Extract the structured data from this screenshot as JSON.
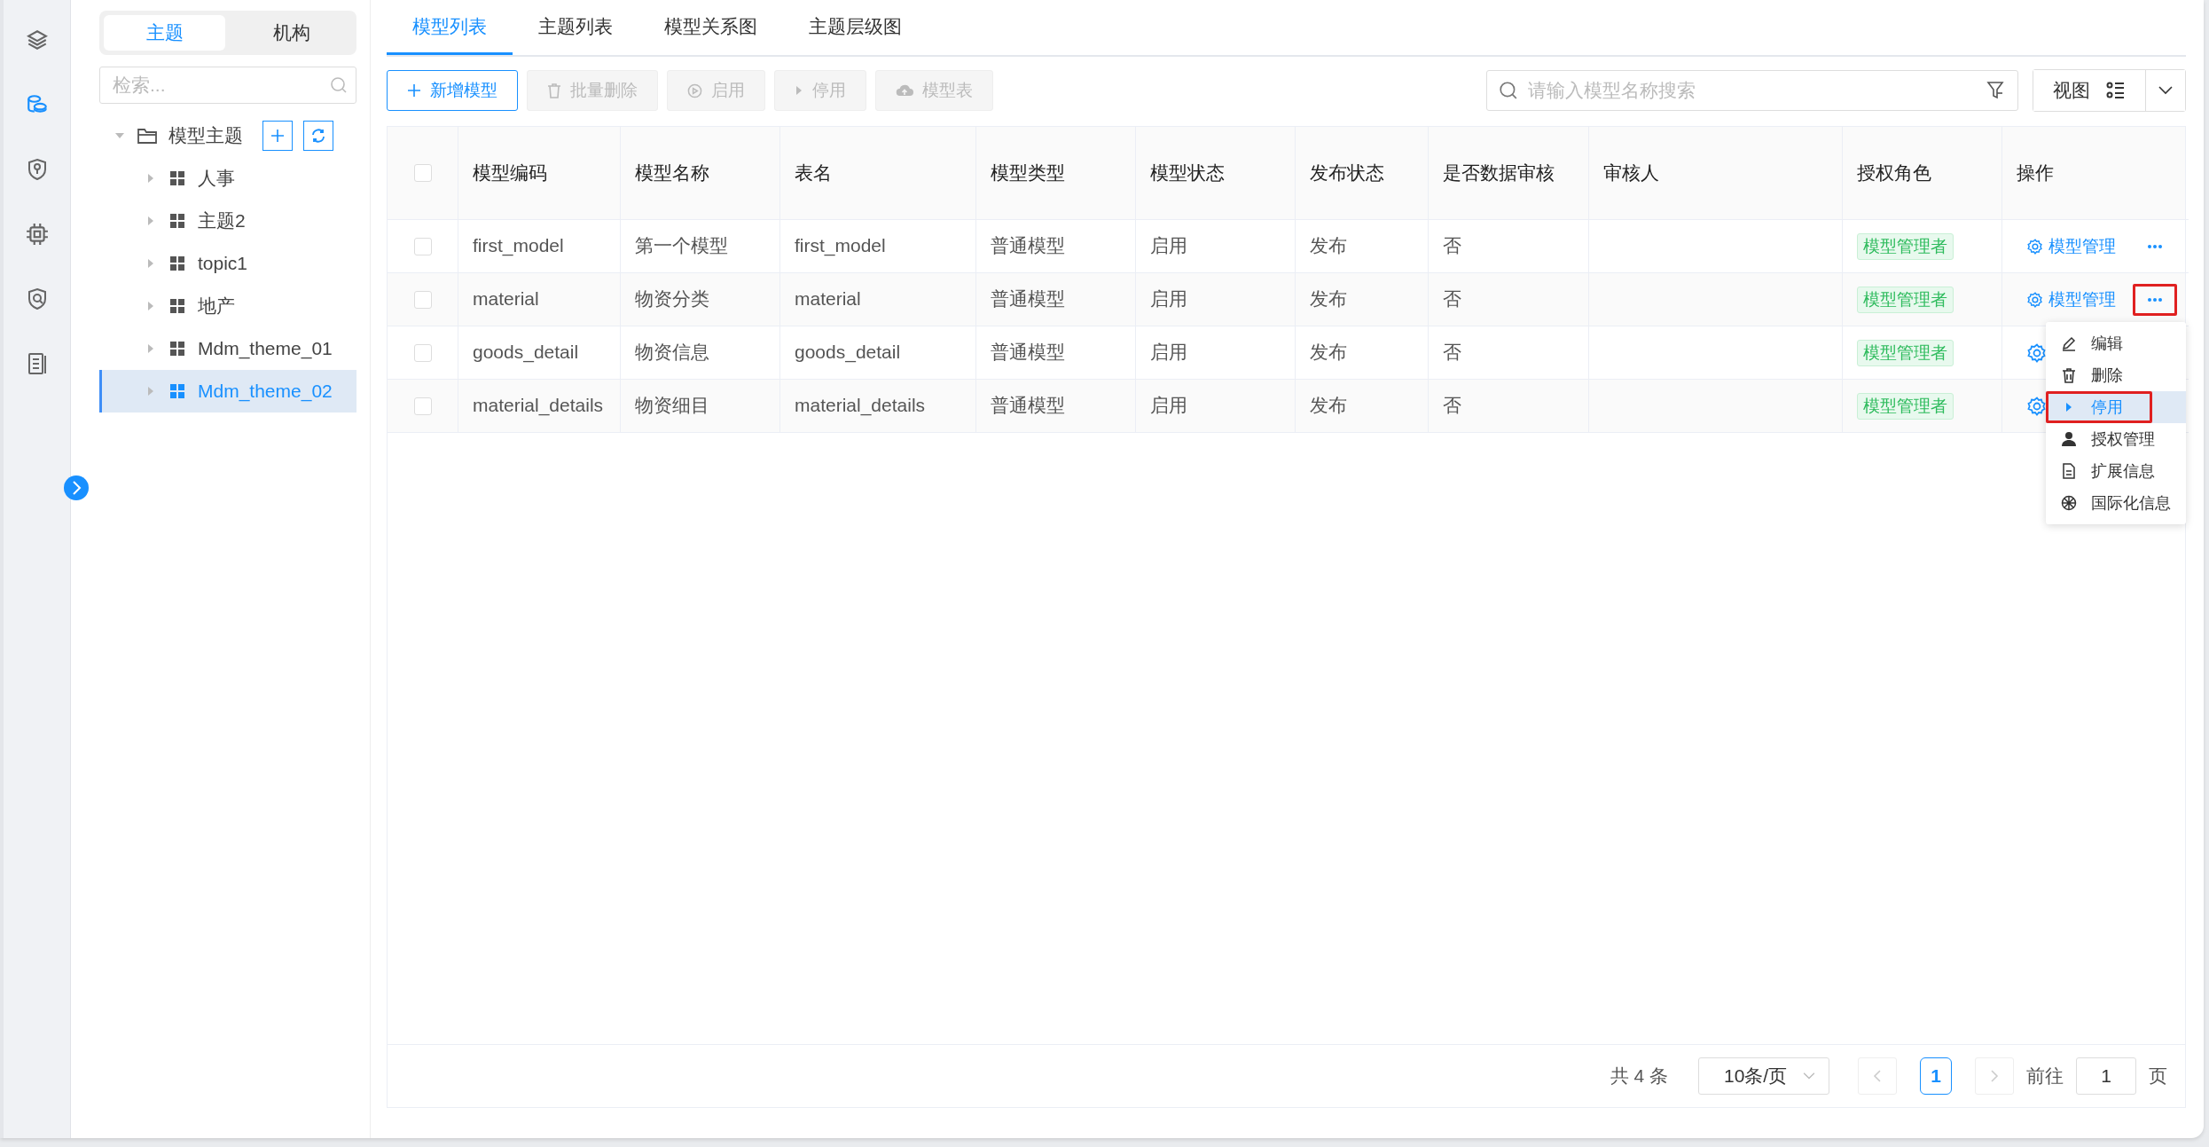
{
  "rail": {
    "items": [
      {
        "selected": false
      },
      {
        "selected": true
      },
      {
        "selected": false
      },
      {
        "selected": false
      },
      {
        "selected": false
      },
      {
        "selected": false
      }
    ]
  },
  "tree_panel": {
    "segments": [
      {
        "label": "主题",
        "selected": true
      },
      {
        "label": "机构",
        "selected": false
      }
    ],
    "search": {
      "placeholder": "检索..."
    },
    "tree": [
      {
        "label": "模型主题",
        "expanded": true,
        "selected": false,
        "children": [
          {
            "label": "人事",
            "expanded": false,
            "selected": false
          },
          {
            "label": "主题2",
            "expanded": false,
            "selected": false
          },
          {
            "label": "topic1",
            "expanded": false,
            "selected": false
          },
          {
            "label": "地产",
            "expanded": false,
            "selected": false
          },
          {
            "label": "Mdm_theme_01",
            "expanded": false,
            "selected": false
          },
          {
            "label": "Mdm_theme_02",
            "expanded": false,
            "selected": true
          }
        ]
      }
    ]
  },
  "tabs": [
    {
      "label": "模型列表",
      "selected": true
    },
    {
      "label": "主题列表",
      "selected": false
    },
    {
      "label": "模型关系图",
      "selected": false
    },
    {
      "label": "主题层级图",
      "selected": false
    }
  ],
  "toolbar": {
    "buttons": [
      {
        "label": "新增模型",
        "kind": "add",
        "disabled": false
      },
      {
        "label": "批量删除",
        "kind": "delete",
        "disabled": true
      },
      {
        "label": "启用",
        "kind": "enable",
        "disabled": true
      },
      {
        "label": "停用",
        "kind": "disable",
        "disabled": true
      },
      {
        "label": "模型表",
        "kind": "upload",
        "disabled": true
      }
    ],
    "search": {
      "placeholder": "请输入模型名称搜索"
    },
    "view_button": {
      "label": "视图"
    }
  },
  "table": {
    "select_all_checked": false,
    "columns": [
      "模型编码",
      "模型名称",
      "表名",
      "模型类型",
      "模型状态",
      "发布状态",
      "是否数据审核",
      "审核人",
      "授权角色",
      "操作"
    ],
    "rows": [
      {
        "checked": false,
        "code": "first_model",
        "name": "第一个模型",
        "table_name": "first_model",
        "type": "普通模型",
        "status": "启用",
        "publish_status": "发布",
        "data_audit": "否",
        "role": "模型管理者",
        "action": "模型管理",
        "more_button": true,
        "more_highlighted": false
      },
      {
        "checked": false,
        "code": "material",
        "name": "物资分类",
        "table_name": "material",
        "type": "普通模型",
        "status": "启用",
        "publish_status": "发布",
        "data_audit": "否",
        "role": "模型管理者",
        "action": "模型管理",
        "more_button": true,
        "more_highlighted": true
      },
      {
        "checked": false,
        "code": "goods_detail",
        "name": "物资信息",
        "table_name": "goods_detail",
        "type": "普通模型",
        "status": "启用",
        "publish_status": "发布",
        "data_audit": "否",
        "role": "模型管理者",
        "more_button": false
      },
      {
        "checked": false,
        "code": "material_details",
        "name": "物资细目",
        "table_name": "material_details",
        "type": "普通模型",
        "status": "启用",
        "publish_status": "发布",
        "data_audit": "否",
        "role": "模型管理者",
        "more_button": false
      }
    ]
  },
  "row_menu": {
    "items": [
      {
        "label": "编辑",
        "kind": "edit",
        "selected": false,
        "highlighted": false
      },
      {
        "label": "删除",
        "kind": "delete",
        "selected": false,
        "highlighted": false
      },
      {
        "label": "停用",
        "kind": "disable",
        "selected": true,
        "highlighted": true
      },
      {
        "label": "授权管理",
        "kind": "user",
        "selected": false,
        "highlighted": false
      },
      {
        "label": "扩展信息",
        "kind": "document",
        "selected": false,
        "highlighted": false
      },
      {
        "label": "国际化信息",
        "kind": "globe",
        "selected": false,
        "highlighted": false
      }
    ]
  },
  "pagination": {
    "total": "共 4 条",
    "page_size": "10条/页",
    "pages": [
      {
        "label": "1",
        "selected": true
      }
    ],
    "goto_label": "前往",
    "goto_value": "1",
    "page_suffix": "页"
  }
}
